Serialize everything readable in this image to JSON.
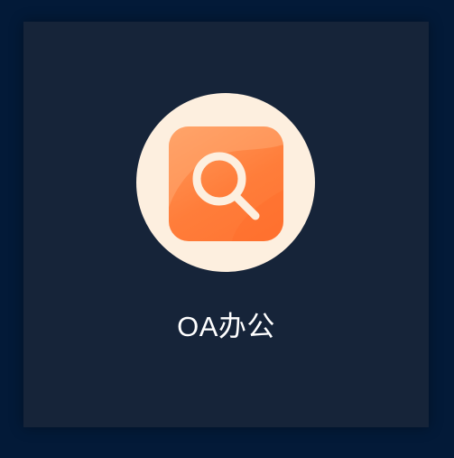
{
  "app": {
    "label": "OA办公",
    "icon_name": "search-icon"
  },
  "colors": {
    "page_background": "#031a38",
    "card_background": "#162439",
    "icon_circle": "#fdefdf",
    "tile_gradient_start": "#ff9a5c",
    "tile_gradient_end": "#ff7432",
    "magnifier_stroke": "#fdefdf",
    "label_text": "#ffffff"
  }
}
